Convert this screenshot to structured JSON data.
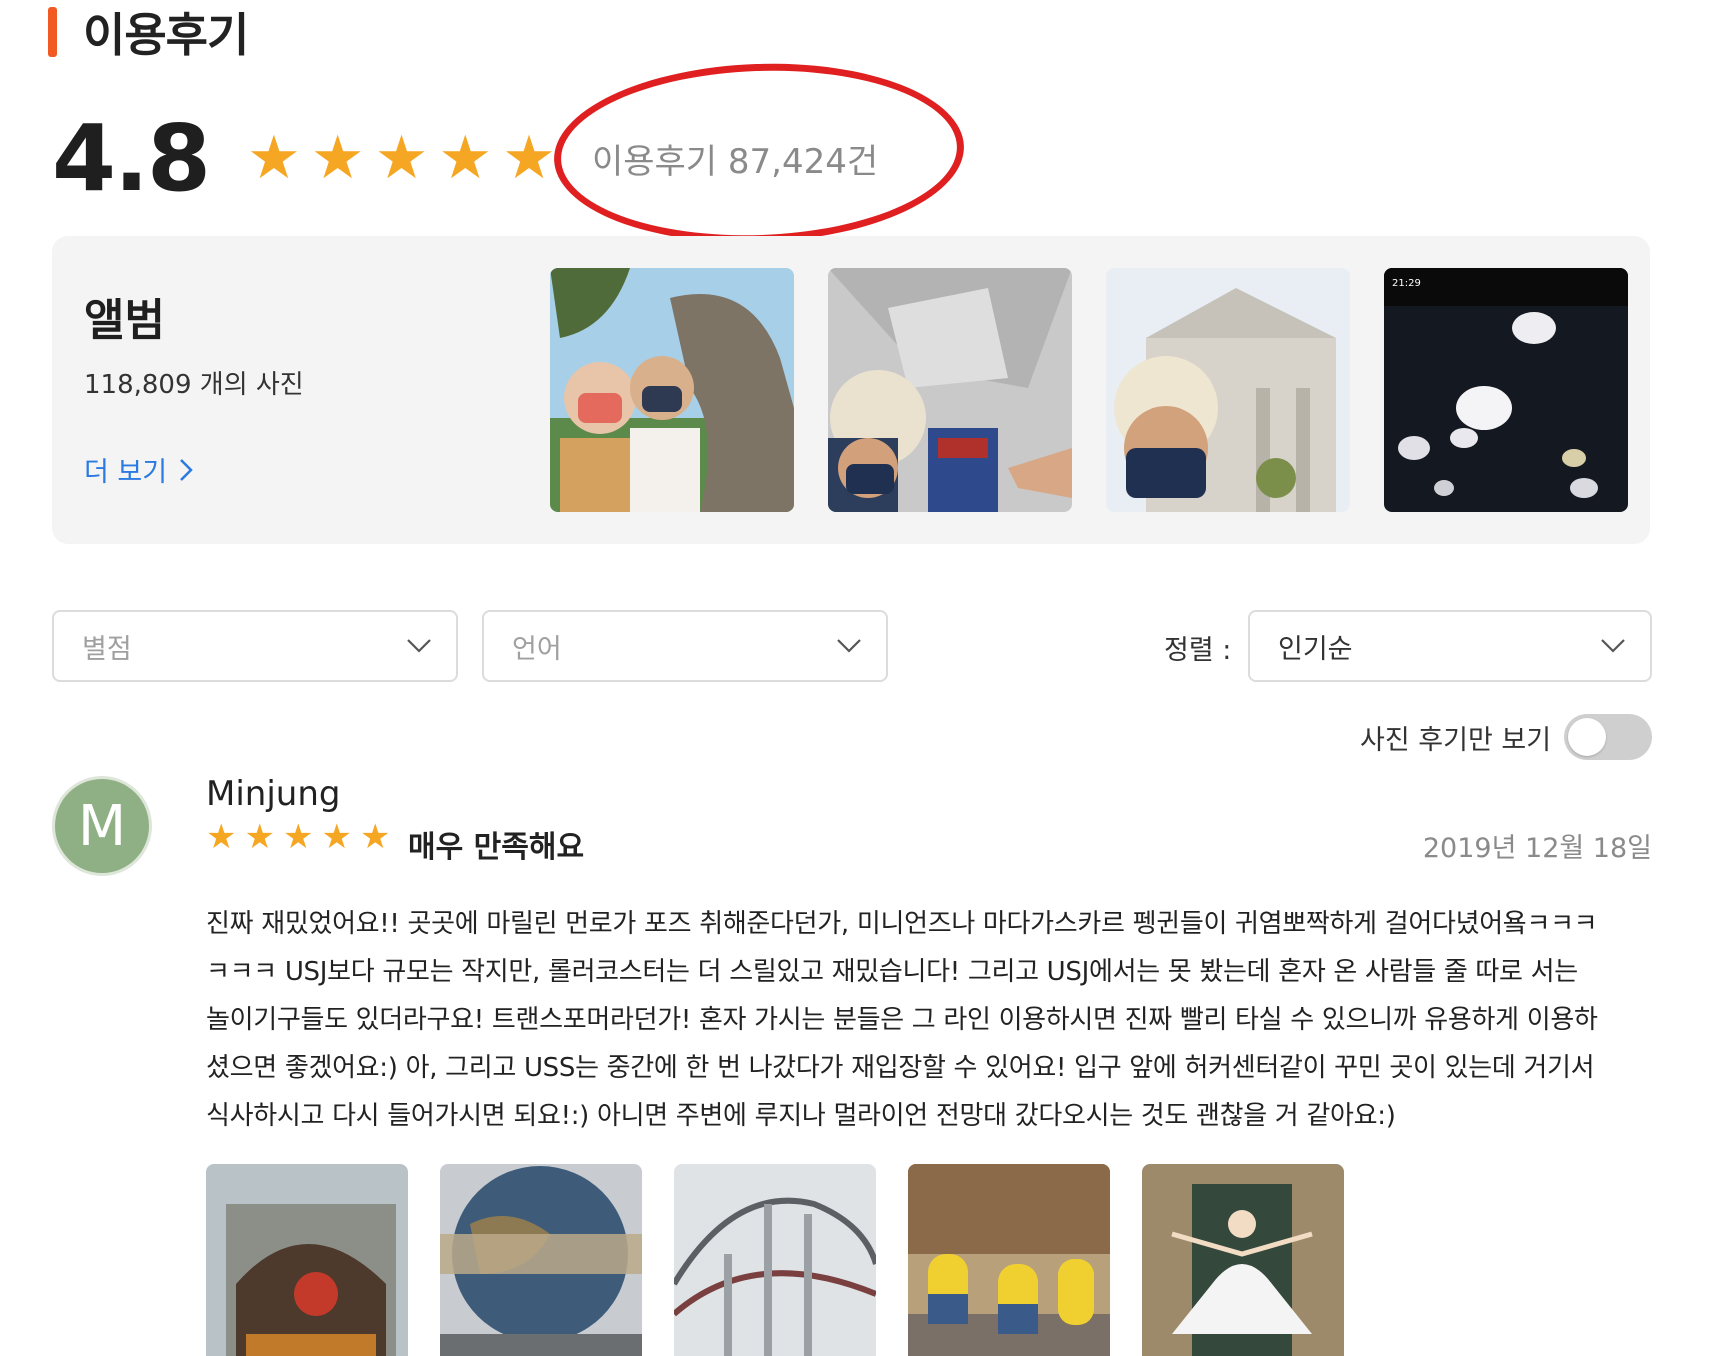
{
  "section": {
    "title": "이용후기"
  },
  "summary": {
    "score": "4.8",
    "rating": 4.8,
    "rating_max": 5,
    "review_count_label": "이용후기 87,424건"
  },
  "album": {
    "title": "앨범",
    "photo_count": "118,809 개의 사진",
    "more_label": "더 보기",
    "photos": [
      {
        "name": "photo-dinosaur-selfie"
      },
      {
        "name": "photo-transformers-selfie"
      },
      {
        "name": "photo-building-selfie"
      },
      {
        "name": "photo-jellyfish"
      }
    ]
  },
  "filters": {
    "rating_placeholder": "별점",
    "language_placeholder": "언어",
    "sort_label": "정렬 :",
    "sort_value": "인기순",
    "photo_only_label": "사진 후기만 보기",
    "photo_only_on": false
  },
  "review": {
    "avatar_letter": "M",
    "name": "Minjung",
    "rating": 5,
    "headline": "매우 만족해요",
    "date": "2019년 12월 18일",
    "lines": [
      "진짜 재밌었어요!! 곳곳에 마릴린 먼로가 포즈 취해준다던가, 미니언즈나 마다가스카르 펭귄들이 귀염뽀짝하게 걸어다녔어욬ㅋㅋㅋ",
      "ㅋㅋㅋ USJ보다 규모는 작지만, 롤러코스터는 더 스릴있고 재밌습니다! 그리고 USJ에서는 못 봤는데 혼자 온 사람들 줄 따로 서는",
      "놀이기구들도 있더라구요! 트랜스포머라던가! 혼자 가시는 분들은 그 라인 이용하시면 진짜 빨리 타실 수 있으니까 유용하게 이용하",
      "셨으면 좋겠어요:) 아, 그리고 USS는 중간에 한 번 나갔다가 재입장할 수 있어요! 입구 앞에 허커센터같이 꾸민 곳이 있는데 거기서",
      "식사하시고 다시 들어가시면 되요!:) 아니면 주변에 루지나 멀라이언 전망대 갔다오시는 것도 괜찮을 거 같아요:)"
    ],
    "photos": [
      {
        "name": "review-photo-sesame-street"
      },
      {
        "name": "review-photo-universal-globe"
      },
      {
        "name": "review-photo-rollercoaster"
      },
      {
        "name": "review-photo-minions"
      },
      {
        "name": "review-photo-marilyn"
      }
    ]
  },
  "colors": {
    "accent": "#f15a22",
    "star": "#f5a623",
    "link": "#2a7ae2",
    "annotation": "#e02020"
  }
}
